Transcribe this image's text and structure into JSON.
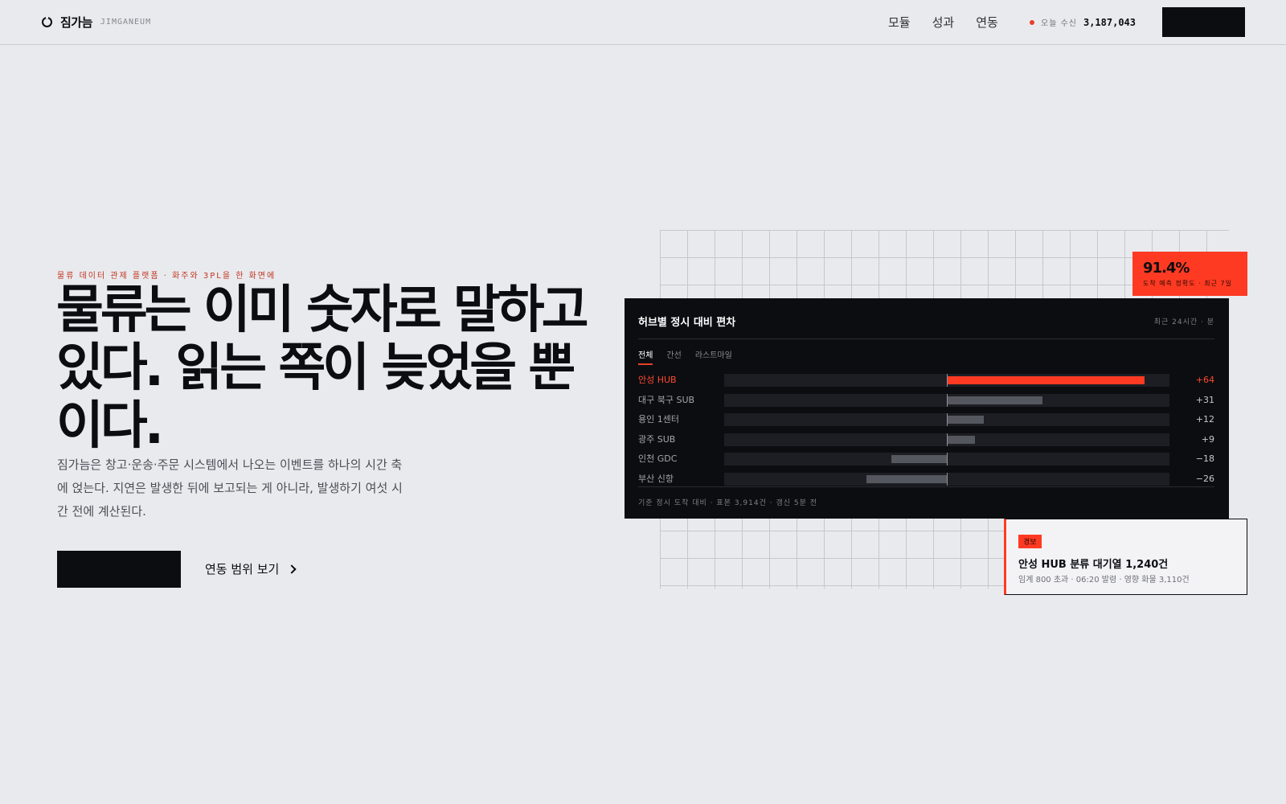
{
  "header": {
    "brand_name": "짐가늠",
    "brand_sub": "JIMGANEUM",
    "nav": [
      "모듈",
      "성과",
      "연동"
    ],
    "ticker_label": "오늘 수신",
    "ticker_value": "3,187,043",
    "cta_label": ""
  },
  "hero": {
    "eyebrow": "물류 데이터 관제 플랫폼 · 화주와 3PL을 한 화면에",
    "headline": "물류는 이미 숫자로 말하고 있다. 읽는 쪽이 늦었을 뿐이다.",
    "lede": "짐가늠은 창고·운송·주문 시스템에서 나오는 이벤트를 하나의 시간 축에 얹는다. 지연은 발생한 뒤에 보고되는 게 아니라, 발생하기 여섯 시간 전에 계산된다.",
    "primary_cta": "",
    "secondary_cta": "연동 범위 보기"
  },
  "panel": {
    "title": "허브별 정시 대비 편차",
    "meta": "최근 24시간 · 분",
    "tabs": [
      "전체",
      "간선",
      "라스트마일"
    ],
    "active_tab": 0,
    "footnote": "기준 정시 도착 대비 · 표본 3,914건 · 갱신 5분 전"
  },
  "chart_data": {
    "type": "bar",
    "orientation": "horizontal",
    "title": "허브별 정시 대비 편차",
    "unit": "분",
    "categories": [
      "안성 HUB",
      "대구 북구 SUB",
      "용인 1센터",
      "광주 SUB",
      "인천 GDC",
      "부산 신항"
    ],
    "values": [
      64,
      31,
      12,
      9,
      -18,
      -26
    ],
    "value_labels": [
      "+64",
      "+31",
      "+12",
      "+9",
      "−18",
      "−26"
    ],
    "highlight_index": 0,
    "xlim": [
      -72,
      72
    ],
    "colors": {
      "highlight": "#ff3a22",
      "default": "#55575e",
      "track": "#1c1e24"
    }
  },
  "stat": {
    "value": "91.4%",
    "caption": "도착 예측 정확도 · 최근 7일"
  },
  "alert": {
    "tag": "경보",
    "title": "안성 HUB 분류 대기열 1,240건",
    "detail": "임계 800 초과 · 06:20 발령 · 영향 화물 3,110건"
  },
  "colors": {
    "accent": "#ff3a22",
    "ink": "#0c0d11",
    "background": "#e9eaee"
  }
}
